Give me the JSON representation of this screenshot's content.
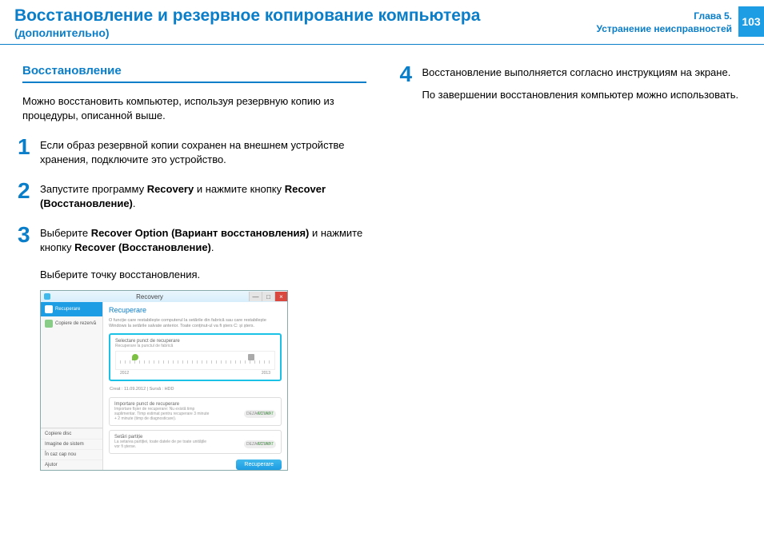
{
  "header": {
    "title": "Восстановление и резервное копирование компьютера",
    "subtitle": "(дополнительно)",
    "chapter": "Глава 5.",
    "chapter_sub": "Устранение неисправностей",
    "page": "103"
  },
  "left": {
    "section_title": "Восстановление",
    "intro": "Можно восстановить компьютер, используя резервную копию из процедуры, описанной выше.",
    "step1": "Если образ резервной копии сохранен на внешнем устройстве хранения, подключите это устройство.",
    "step2_a": "Запустите программу ",
    "step2_b": "Recovery",
    "step2_c": " и нажмите кнопку ",
    "step2_d": "Recover (Восстановление)",
    "step2_e": ".",
    "step3_a": "Выберите ",
    "step3_b": "Recover Option (Вариант восстановления)",
    "step3_c": " и нажмите кнопку ",
    "step3_d": "Recover (Восстановление)",
    "step3_e": ".",
    "step3_sub": "Выберите точку восстановления."
  },
  "right": {
    "step4_a": "Восстановление выполняется согласно инструкциям на экране.",
    "step4_b": "По завершении восстановления компьютер можно использовать."
  },
  "app": {
    "title": "Recovery",
    "side_recover": "Recuperare",
    "side_backup": "Copiere de rezervă",
    "side_copy": "Copiere disc",
    "side_image": "Imagine de sistem",
    "side_erase": "În caz cap nou",
    "side_help": "Ajutor",
    "panel_title": "Recuperare",
    "panel_desc": "O funcție care restabilește computerul la setările din fabrică sau care restabilește Windows la setările salvate anterior. Toate conținut-ul va fi șters C: și șters.",
    "card1_title": "Selectare punct de recuperare",
    "card1_desc": "Recuperare la punctul de fabrică",
    "tl_left": "2012",
    "tl_right": "2013",
    "meta": "Creat :  11.09.2012   |  Sursă :  HDD",
    "card2_title": "Importare punct de recuperare",
    "card2_desc": "Importare fișier de recuperare: Nu există timp suplimentar. Timp estimat pentru recuperare 3 minute + 2 minute (timp de diagnosticare).",
    "off": "DEZACTIVAT",
    "on": "ACTIVAT",
    "card3_title": "Setări partiție",
    "card3_desc": "La setarea partiției, toate datele de pe toate unitățile vor fi șterse.",
    "recover_btn": "Recuperare"
  }
}
